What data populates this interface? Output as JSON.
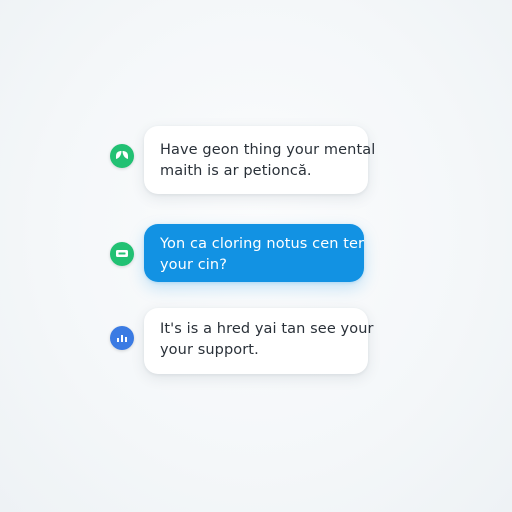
{
  "messages": [
    {
      "avatar_icon": "leaf-icon",
      "avatar_color": "#22c173",
      "lines": [
        "Have geon thing your mental",
        "maith is ar petioncă."
      ]
    },
    {
      "avatar_icon": "chat-icon",
      "avatar_color": "#22c173",
      "bubble_color": "#1292e3",
      "lines": [
        "Yon ca cloring notus cen ter",
        "your cin?"
      ]
    },
    {
      "avatar_icon": "chart-icon",
      "avatar_color": "#3b7be3",
      "lines": [
        "It's is a hred yai tan see your",
        "your support."
      ]
    }
  ]
}
